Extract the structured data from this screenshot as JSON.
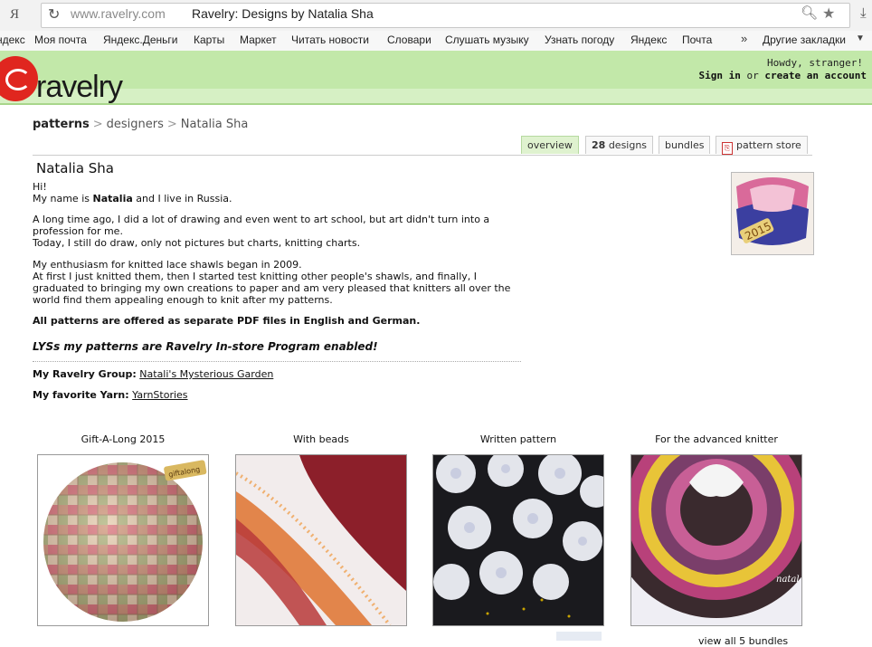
{
  "browser": {
    "logo": "Я",
    "url": "www.ravelry.com",
    "title": "Ravelry: Designs by Natalia Sha",
    "bookmarks": [
      "ндекс",
      "Моя почта",
      "Яндекс.Деньги",
      "Карты",
      "Маркет",
      "Читать новости",
      "Словари",
      "Слушать музыку",
      "Узнать погоду",
      "Яндекс",
      "Почта"
    ],
    "more": "»",
    "other_bookmarks": "Другие закладки"
  },
  "header": {
    "logo": "ravelry",
    "greeting": "Howdy, stranger!",
    "sign_in": "Sign in",
    "or": "or",
    "create_account": "create an account"
  },
  "breadcrumb": {
    "patterns": "patterns",
    "sep": ">",
    "designers": "designers",
    "designer": "Natalia Sha"
  },
  "tabs": {
    "overview": "overview",
    "designs_count": "28",
    "designs": "designs",
    "bundles": "bundles",
    "store": "pattern store"
  },
  "profile": {
    "name": "Natalia Sha",
    "hi": "Hi!",
    "intro_a": "My name is ",
    "intro_name": "Natalia",
    "intro_b": " and I live in Russia.",
    "para1_a": "A long time ago, I did a lot of drawing and even went to art school, but art didn't turn into a profession for me.",
    "para1_b": "Today, I still do draw, only not pictures but charts, knitting charts.",
    "para2_a": "My enthusiasm for knitted lace shawls began in 2009.",
    "para2_b": "At first I just knitted them, then I started test knitting other people's shawls, and finally, I graduated to bringing my own creations to paper and am very pleased that knitters all over the world find them appealing enough to knit after my patterns.",
    "pdf_note": "All patterns are offered as separate PDF files in English and German.",
    "lys": "LYSs my patterns are Ravelry In-store Program enabled!",
    "group_label": "My Ravelry Group:",
    "group_link": "Natali's Mysterious Garden",
    "yarn_label": "My favorite Yarn:",
    "yarn_link": "YarnStories",
    "avatar_badge": "2015"
  },
  "bundles": [
    {
      "caption": "Gift-A-Long 2015",
      "tag": "giftalong"
    },
    {
      "caption": "With beads"
    },
    {
      "caption": "Written pattern"
    },
    {
      "caption": "For the advanced knitter",
      "watermark": "natal"
    }
  ],
  "view_all": "view all 5 bundles",
  "colors": {
    "header_green": "#c2e8a9",
    "logo_red": "#e0261f"
  }
}
